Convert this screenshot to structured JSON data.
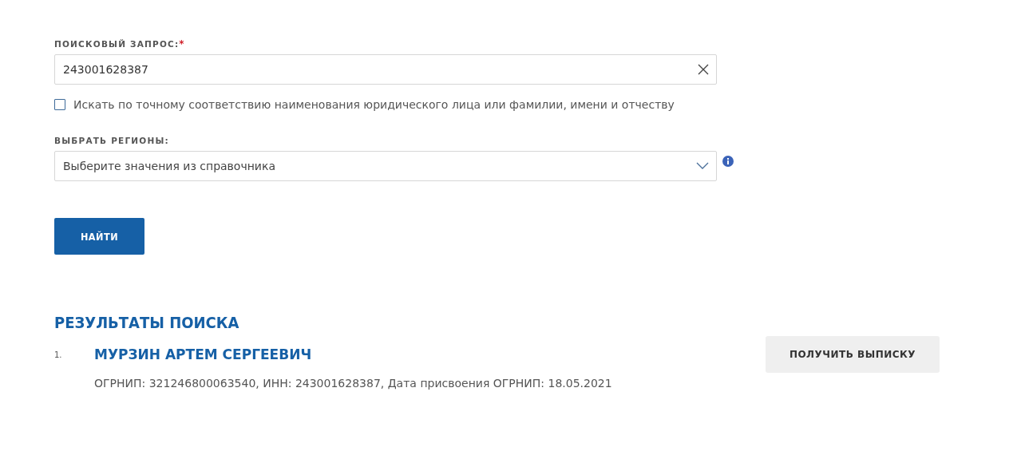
{
  "search_query": {
    "label": "ПОИСКОВЫЙ ЗАПРОС:",
    "required_mark": "*",
    "value": "243001628387"
  },
  "exact_match": {
    "label": "Искать по точному соответствию наименования юридического лица или фамилии, имени и отчеству",
    "checked": false
  },
  "regions": {
    "label": "ВЫБРАТЬ РЕГИОНЫ:",
    "placeholder": "Выберите значения из справочника"
  },
  "find_button": "НАЙТИ",
  "results": {
    "title": "РЕЗУЛЬТАТЫ ПОИСКА",
    "items": [
      {
        "number": "1.",
        "name": "МУРЗИН АРТЕМ СЕРГЕЕВИЧ",
        "details": "ОГРНИП: 321246800063540, ИНН: 243001628387, Дата присвоения ОГРНИП: 18.05.2021",
        "action": "ПОЛУЧИТЬ ВЫПИСКУ"
      }
    ]
  }
}
